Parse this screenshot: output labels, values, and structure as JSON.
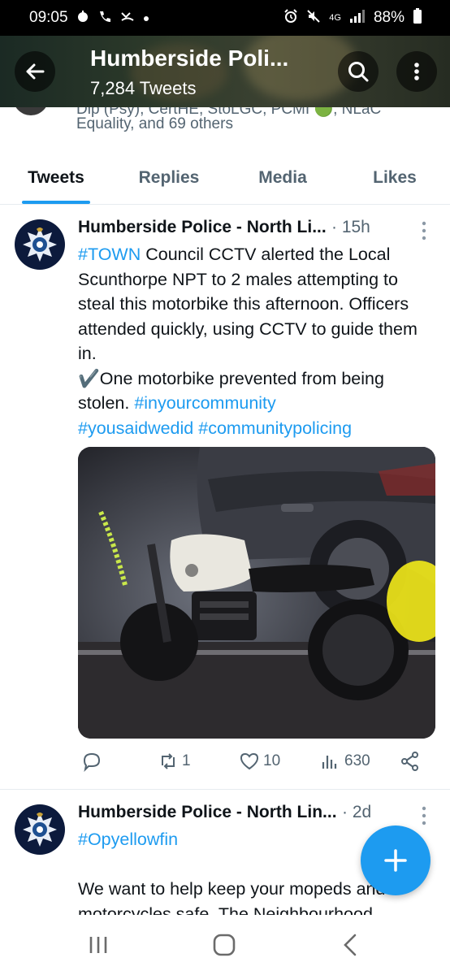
{
  "status_bar": {
    "time": "09:05",
    "battery": "88%",
    "network": "4G",
    "left_icons": [
      "photo-icon",
      "call-icon",
      "missed-call-icon",
      "dot-icon"
    ],
    "right_icons": [
      "alarm-icon",
      "mute-icon",
      "network-icon",
      "signal-icon",
      "battery-icon"
    ]
  },
  "header": {
    "title": "Humberside Poli...",
    "subtitle": "7,284 Tweets"
  },
  "profile_peek": {
    "cut_line": "Dip (Psy), CertHE, StoLGC, PCMI 🟢, NLaC",
    "line": "Equality, and 69 others"
  },
  "tabs": [
    {
      "label": "Tweets",
      "active": true
    },
    {
      "label": "Replies",
      "active": false
    },
    {
      "label": "Media",
      "active": false
    },
    {
      "label": "Likes",
      "active": false
    }
  ],
  "tweets": [
    {
      "author": "Humberside Police - North Li...",
      "time": "· 15h",
      "text_parts": [
        {
          "t": "#TOWN",
          "tag": true
        },
        {
          "t": " Council CCTV alerted the Local Scunthorpe NPT to 2 males attempting to steal this motorbike this afternoon. Officers attended quickly, using  CCTV to guide them in.",
          "tag": false
        },
        {
          "t": "\n✔️One motorbike prevented from being stolen. ",
          "tag": false
        },
        {
          "t": "#inyourcommunity",
          "tag": true
        },
        {
          "t": "\n",
          "tag": false
        },
        {
          "t": "#yousaidwedid",
          "tag": true
        },
        {
          "t": " ",
          "tag": false
        },
        {
          "t": "#communitypolicing",
          "tag": true
        }
      ],
      "retweets": "1",
      "likes": "10",
      "views": "630"
    },
    {
      "author": "Humberside Police - North Lin...",
      "time": "· 2d",
      "text_parts": [
        {
          "t": "#Opyellowfin",
          "tag": true
        },
        {
          "t": "\n\nWe want to help keep your mopeds and motorcycles safe. The Neighbourhood",
          "tag": false
        }
      ]
    }
  ],
  "colors": {
    "accent": "#1d9bf0",
    "text": "#0f1419",
    "muted": "#536471",
    "police_badge": "#0c1a3c"
  }
}
